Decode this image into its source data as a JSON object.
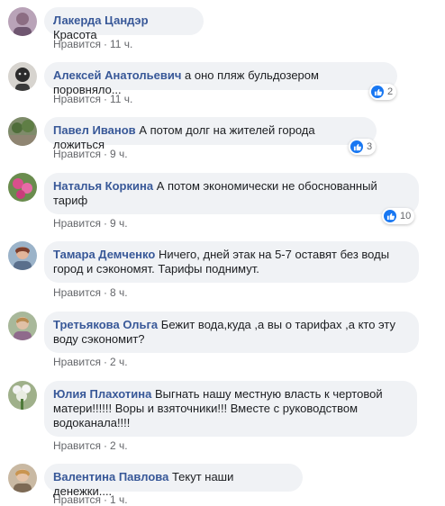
{
  "comments": [
    {
      "author": "Лакерда Цандэр",
      "text": "Красота",
      "like": "Нравится",
      "time": "11 ч.",
      "reactions": ""
    },
    {
      "author": "Алексей Анатольевич",
      "text": "а оно пляж бульдозером поровняло...",
      "like": "Нравится",
      "time": "11 ч.",
      "reactions": "2"
    },
    {
      "author": "Павел Иванов",
      "text": "А потом долг на жителей города ложиться",
      "like": "Нравится",
      "time": "9 ч.",
      "reactions": "3"
    },
    {
      "author": "Наталья Коркина",
      "text": "А потом экономически не обоснованный тариф",
      "like": "Нравится",
      "time": "9 ч.",
      "reactions": "10"
    },
    {
      "author": "Тамара Демченко",
      "text": "Ничего, дней этак на 5-7 оставят без воды город и сэкономят. Тарифы поднимут.",
      "like": "Нравится",
      "time": "8 ч.",
      "reactions": ""
    },
    {
      "author": "Третьякова Ольга",
      "text": "Бежит вода,куда ,а вы о тарифах ,а кто эту воду сэкономит?",
      "like": "Нравится",
      "time": "2 ч.",
      "reactions": ""
    },
    {
      "author": "Юлия Плахотина",
      "text": "Выгнать нашу местную власть к чертовой матери!!!!!! Воры и взяточники!!! Вместе с руководством водоканала!!!!",
      "like": "Нравится",
      "time": "2 ч.",
      "reactions": ""
    },
    {
      "author": "Валентина Павлова",
      "text": "Текут наши денежки....",
      "like": "Нравится",
      "time": "1 ч.",
      "reactions": ""
    }
  ],
  "separator": "·",
  "icons": {
    "reaction": "thumbs-up-icon"
  },
  "colors": {
    "author": "#385898",
    "bubble": "#f0f2f5",
    "meta": "#65676b",
    "like_badge": "#1877f2"
  }
}
